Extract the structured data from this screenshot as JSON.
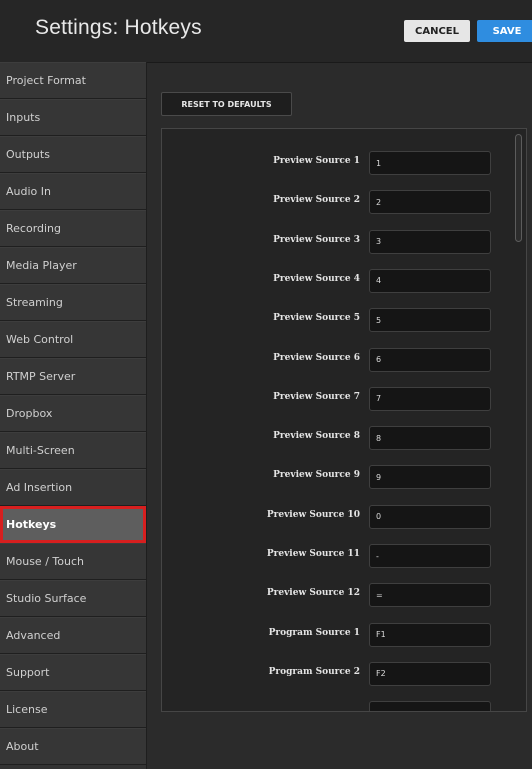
{
  "header": {
    "title": "Settings: Hotkeys",
    "cancel_label": "CANCEL",
    "save_label": "SAVE",
    "save_color": "#2f8de0"
  },
  "sidebar": {
    "items": [
      {
        "label": "Project Format"
      },
      {
        "label": "Inputs"
      },
      {
        "label": "Outputs"
      },
      {
        "label": "Audio In"
      },
      {
        "label": "Recording"
      },
      {
        "label": "Media Player"
      },
      {
        "label": "Streaming"
      },
      {
        "label": "Web Control"
      },
      {
        "label": "RTMP Server"
      },
      {
        "label": "Dropbox"
      },
      {
        "label": "Multi-Screen"
      },
      {
        "label": "Ad Insertion"
      },
      {
        "label": "Hotkeys"
      },
      {
        "label": "Mouse / Touch"
      },
      {
        "label": "Studio Surface"
      },
      {
        "label": "Advanced"
      },
      {
        "label": "Support"
      },
      {
        "label": "License"
      },
      {
        "label": "About"
      }
    ],
    "active": "Hotkeys",
    "highlight_color": "#d71f1f"
  },
  "main": {
    "reset_label": "RESET TO DEFAULTS",
    "hotkeys": [
      {
        "label": "Preview Source 1",
        "value": "1"
      },
      {
        "label": "Preview Source 2",
        "value": "2"
      },
      {
        "label": "Preview Source 3",
        "value": "3"
      },
      {
        "label": "Preview Source 4",
        "value": "4"
      },
      {
        "label": "Preview Source 5",
        "value": "5"
      },
      {
        "label": "Preview Source 6",
        "value": "6"
      },
      {
        "label": "Preview Source 7",
        "value": "7"
      },
      {
        "label": "Preview Source 8",
        "value": "8"
      },
      {
        "label": "Preview Source 9",
        "value": "9"
      },
      {
        "label": "Preview Source 10",
        "value": "0"
      },
      {
        "label": "Preview Source 11",
        "value": "-"
      },
      {
        "label": "Preview Source 12",
        "value": "="
      },
      {
        "label": "Program Source 1",
        "value": "F1"
      },
      {
        "label": "Program Source 2",
        "value": "F2"
      },
      {
        "label": "",
        "value": ""
      }
    ]
  }
}
